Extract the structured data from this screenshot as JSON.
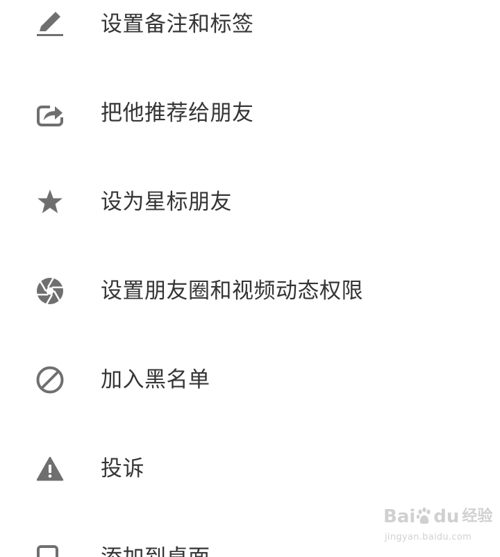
{
  "menu": {
    "items": [
      {
        "label": "设置备注和标签",
        "icon": "pencil-icon"
      },
      {
        "label": "把他推荐给朋友",
        "icon": "share-icon"
      },
      {
        "label": "设为星标朋友",
        "icon": "star-icon"
      },
      {
        "label": "设置朋友圈和视频动态权限",
        "icon": "aperture-icon"
      },
      {
        "label": "加入黑名单",
        "icon": "block-icon"
      },
      {
        "label": "投诉",
        "icon": "warning-icon"
      },
      {
        "label": "添加到桌面",
        "icon": "add-to-desktop-icon"
      }
    ]
  },
  "colors": {
    "background": "#ffffff",
    "text": "#353535",
    "icon": "#6f6f6f"
  },
  "watermark": {
    "brand_left": "Bai",
    "brand_right": "du",
    "product": "经验",
    "url": "jingyan.baidu.com"
  }
}
